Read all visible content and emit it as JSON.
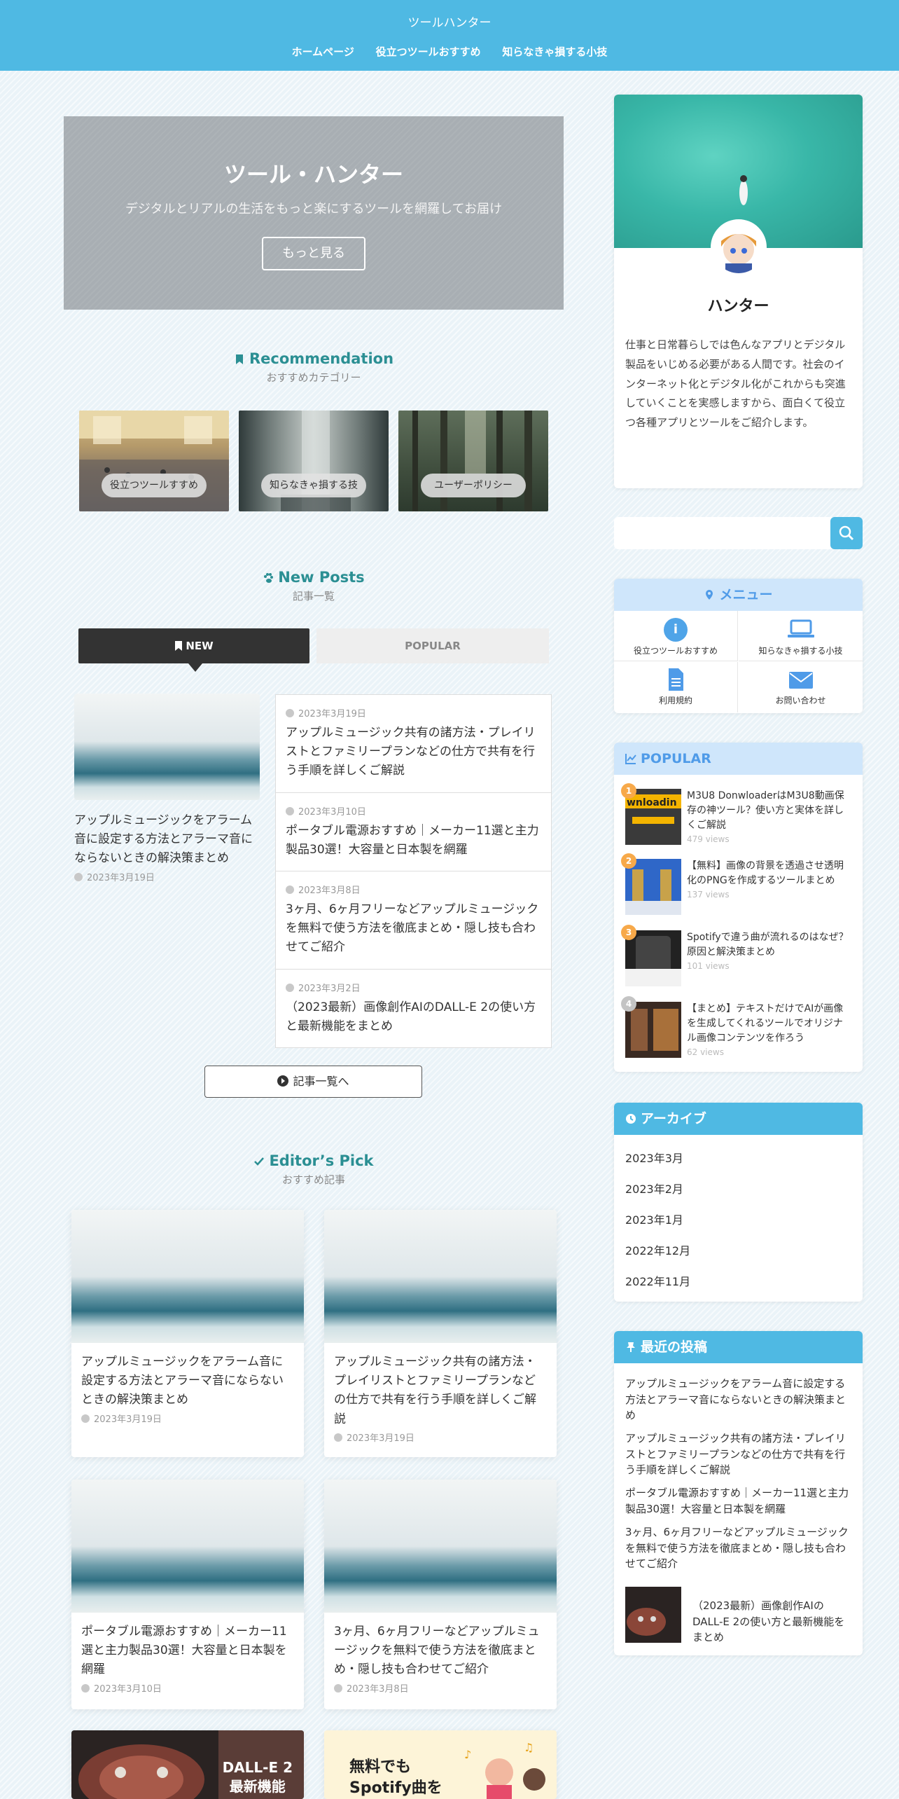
{
  "header": {
    "site_title": "ツールハンター",
    "nav": [
      "ホームページ",
      "役立つツールおすすめ",
      "知らなきゃ損する小技"
    ]
  },
  "hero": {
    "title": "ツール・ハンター",
    "subtitle": "デジタルとリアルの生活をもっと楽にするツールを網羅してお届け",
    "button": "もっと見る"
  },
  "recommendation": {
    "title": "Recommendation",
    "subtitle": "おすすめカテゴリー",
    "categories": [
      "役立つツールすすめ",
      "知らなきゃ損する技",
      "ユーザーポリシー"
    ]
  },
  "new_posts": {
    "title": "New Posts",
    "subtitle": "記事一覧",
    "tab_new": "NEW",
    "tab_popular": "POPULAR",
    "featured": {
      "title": "アップルミュージックをアラーム音に設定する方法とアラーマ音にならないときの解決策まとめ",
      "date": "2023年3月19日"
    },
    "list": [
      {
        "date": "2023年3月19日",
        "title": "アップルミュージック共有の諸方法・プレイリストとファミリープランなどの仕方で共有を行う手順を詳しくご解説"
      },
      {
        "date": "2023年3月10日",
        "title": "ポータブル電源おすすめ｜メーカー11選と主力製品30選！大容量と日本製を網羅"
      },
      {
        "date": "2023年3月8日",
        "title": "3ヶ月、6ヶ月フリーなどアップルミュージックを無料で使う方法を徹底まとめ・隠し技も合わせてご紹介"
      },
      {
        "date": "2023年3月2日",
        "title": "（2023最新）画像創作AIのDALL-E 2の使い方と最新機能をまとめ"
      }
    ],
    "more_button": "記事一覧へ"
  },
  "editors_pick": {
    "title": "Editor’s Pick",
    "subtitle": "おすすめ記事",
    "cards": [
      {
        "title": "アップルミュージックをアラーム音に設定する方法とアラーマ音にならないときの解決策まとめ",
        "date": "2023年3月19日"
      },
      {
        "title": "アップルミュージック共有の諸方法・プレイリストとファミリープランなどの仕方で共有を行う手順を詳しくご解説",
        "date": "2023年3月19日"
      },
      {
        "title": "ポータブル電源おすすめ｜メーカー11選と主力製品30選！大容量と日本製を網羅",
        "date": "2023年3月10日"
      },
      {
        "title": "3ヶ月、6ヶ月フリーなどアップルミュージックを無料で使う方法を徹底まとめ・隠し技も合わせてご紹介",
        "date": "2023年3月8日"
      }
    ],
    "bottom_left_text": [
      "DALL-E 2",
      "最新機能"
    ],
    "bottom_right_text": [
      "無料でも",
      "Spotify曲を"
    ]
  },
  "profile": {
    "name": "ハンター",
    "bio": "仕事と日常暮らしでは色んなアプリとデジタル製品をいじめる必要がある人間です。社会のインターネット化とデジタル化がこれからも突進していくことを実感しますから、面白くて役立つ各種アプリとツールをご紹介します。"
  },
  "menu_widget": {
    "title": "メニュー",
    "items": [
      "役立つツールおすすめ",
      "知らなきゃ損する小技",
      "利用規約",
      "お問い合わせ"
    ]
  },
  "popular_widget": {
    "title": "POPULAR",
    "items": [
      {
        "rank": "1",
        "title": "M3U8 DonwloaderはM3U8動画保存の神ツール？使い方と実体を詳しくご解説",
        "views": "479 views",
        "thumb_text": "wnloadin"
      },
      {
        "rank": "2",
        "title": "【無料】画像の背景を透過させ透明化のPNGを作成するツールまとめ",
        "views": "137 views",
        "thumb_text": ""
      },
      {
        "rank": "3",
        "title": "Spotifyで違う曲が流れるのはなぜ？原因と解決策まとめ",
        "views": "101 views",
        "thumb_text": ""
      },
      {
        "rank": "4",
        "title": "【まとめ】テキストだけでAIが画像を生成してくれるツールでオリジナル画像コンテンツを作ろう",
        "views": "62 views",
        "thumb_text": ""
      }
    ]
  },
  "archive_widget": {
    "title": "アーカイブ",
    "items": [
      "2023年3月",
      "2023年2月",
      "2023年1月",
      "2022年12月",
      "2022年11月"
    ]
  },
  "recent_widget": {
    "title": "最近の投稿",
    "items": [
      "アップルミュージックをアラーム音に設定する方法とアラーマ音にならないときの解決策まとめ",
      "アップルミュージック共有の諸方法・プレイリストとファミリープランなどの仕方で共有を行う手順を詳しくご解説",
      "ポータブル電源おすすめ｜メーカー11選と主力製品30選！大容量と日本製を網羅",
      "3ヶ月、6ヶ月フリーなどアップルミュージックを無料で使う方法を徹底まとめ・隠し技も合わせてご紹介",
      "（2023最新）画像創作AIのDALL-E 2の使い方と最新機能をまとめ"
    ]
  },
  "colors": {
    "header": "#4fb9e3",
    "accent_teal": "#2b8f93",
    "widget_head": "#4fb9e3",
    "menu_head": "#cfe6fb"
  }
}
